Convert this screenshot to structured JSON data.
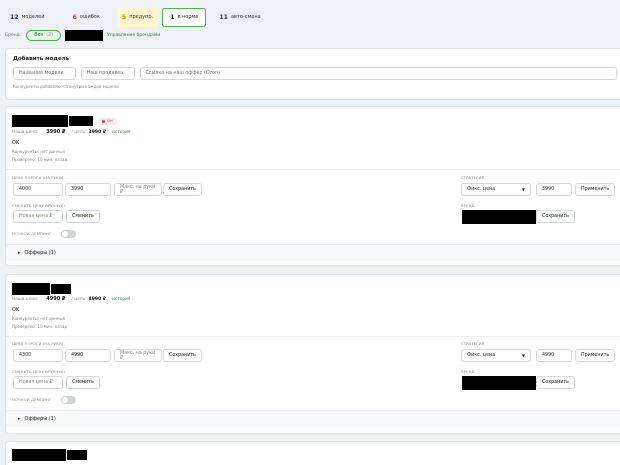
{
  "stats": [
    {
      "count": "12",
      "label": "моделей"
    },
    {
      "count": "6",
      "label": "ошибок"
    },
    {
      "count": "5",
      "label": "предупр."
    },
    {
      "count": "1",
      "label": "в норме"
    },
    {
      "count": "11",
      "label": "авто-смена"
    }
  ],
  "brand_filter": {
    "label": "Бренд:",
    "all_label": "Все",
    "all_count": "(2)",
    "manage_link": "Управление брендами"
  },
  "add_model": {
    "title": "Добавить модель",
    "model_name_placeholder": "Название модели",
    "our_seller_placeholder": "Наш продавец",
    "offer_link_placeholder": "Ссылка на наш оффер (Ozon)",
    "hint": "Конкуренты добавляются внутри каждой модели"
  },
  "cards": [
    {
      "badge": "ОН",
      "our_price_label": "Наша цена:",
      "our_price": "3990 ₽",
      "goal_label": "/ цель:",
      "goal_price": "3990 ₽",
      "history_link": "история",
      "status": "OK",
      "competitors": "Конкуренты: нет данных",
      "checked": "Проверено: 10 мин. назад",
      "price_thresholds_label": "ЦЕНА ПОРОГИ (НА РУКИ)",
      "min_value": "4000",
      "max_value": "3990",
      "max_placeholder": "Макс. на руки ₽",
      "save_label": "Сохранить",
      "strategy_label": "СТРАТЕГИЯ",
      "strategy_value": "Фикс. цена",
      "strategy_price": "3990",
      "apply_label": "Применить",
      "manual_label": "СМЕНИТЬ ЦЕНУ ВРУЧНУЮ",
      "new_price_placeholder": "Новая цена ₽",
      "change_label": "Сменить",
      "brand_label": "БРЕНД",
      "brand_save_label": "Сохранить",
      "night_label": "НОЧНОЙ ДЕМПИНГ",
      "offers_label": "Офферы (1)"
    },
    {
      "our_price_label": "Наша цена:",
      "our_price": "4990 ₽",
      "goal_label": "/ цель:",
      "goal_price": "4990 ₽",
      "history_link": "история",
      "status": "OK",
      "competitors": "Конкуренты: нет данных",
      "checked": "Проверено: 10 мин. назад",
      "price_thresholds_label": "ЦЕНА ПОРОГИ (НА РУКИ)",
      "min_value": "4300",
      "max_value": "4990",
      "max_placeholder": "Макс. на руки ₽",
      "save_label": "Сохранить",
      "strategy_label": "СТРАТЕГИЯ",
      "strategy_value": "Фикс. цена",
      "strategy_price": "4990",
      "apply_label": "Применить",
      "manual_label": "СМЕНИТЬ ЦЕНУ ВРУЧНУЮ",
      "new_price_placeholder": "Новая цена ₽",
      "change_label": "Сменить",
      "brand_label": "БРЕНД",
      "brand_save_label": "Сохранить",
      "night_label": "НОЧНОЙ ДЕМПИНГ",
      "offers_label": "Офферы (1)"
    }
  ],
  "colors": {
    "error": "#e53935",
    "warning": "#d39a00",
    "ok_border": "#4caf50",
    "link": "#2e7d32"
  }
}
